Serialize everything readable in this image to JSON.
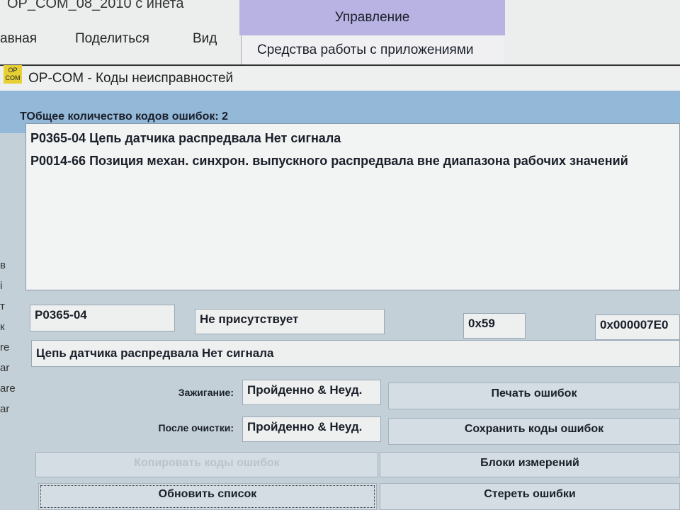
{
  "explorer": {
    "title": "OP_COM_08_2010 с инета",
    "tabs": [
      "авная",
      "Поделиться",
      "Вид"
    ],
    "manage": "Управление",
    "tools": "Средства работы с приложениями"
  },
  "window": {
    "title": "OP-COM - Коды неисправностей",
    "logo": "OP COM"
  },
  "summary": {
    "label": "ТОбщее количество кодов ошибок:",
    "count": "2"
  },
  "codes": [
    "P0365-04 Цепь датчика распредвала Нет сигнала",
    "P0014-66 Позиция механ. синхрон. выпускного распредвала вне диапазона рабочих значений"
  ],
  "detail": {
    "code": "P0365-04",
    "status": "Не присутствует",
    "value1": "0x59",
    "value2": "0x000007E0",
    "description": "Цепь датчика распредвала Нет сигнала"
  },
  "ignition": {
    "label": "Зажигание:",
    "value": "Пройденно & Неуд."
  },
  "after_clear": {
    "label": "После очистки:",
    "value": "Пройденно & Неуд."
  },
  "buttons": {
    "print": "Печать ошибок",
    "save": "Сохранить коды ошибок",
    "copy": "Копировать коды ошибок",
    "blocks": "Блоки измерений",
    "refresh": "Обновить список",
    "clear": "Стереть ошибки"
  },
  "side_letters": [
    "в",
    "і",
    "т",
    "к",
    "re",
    "ar",
    "are",
    "ar"
  ]
}
